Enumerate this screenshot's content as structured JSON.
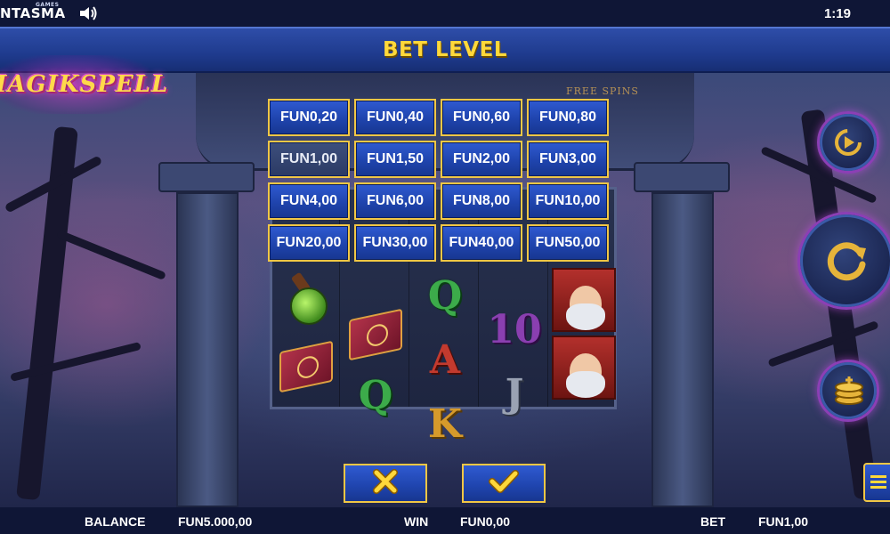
{
  "status_bar": {
    "brand": "NTASMA",
    "brand_small": "GAMES",
    "clock": "1:19",
    "sound_icon": "speaker-icon"
  },
  "header": {
    "title": "BET LEVEL"
  },
  "logo": {
    "text": "MAGIKSPELL"
  },
  "scene": {
    "free_spins_label": "FREE SPINS"
  },
  "bet_options": [
    "FUN0,20",
    "FUN0,40",
    "FUN0,60",
    "FUN0,80",
    "FUN1,00",
    "FUN1,50",
    "FUN2,00",
    "FUN3,00",
    "FUN4,00",
    "FUN6,00",
    "FUN8,00",
    "FUN10,00",
    "FUN20,00",
    "FUN30,00",
    "FUN40,00",
    "FUN50,00"
  ],
  "selected_bet_index": 4,
  "actions": {
    "cancel_icon": "close-icon",
    "confirm_icon": "check-icon"
  },
  "controls": {
    "autoplay_icon": "autoplay-icon",
    "spin_icon": "spin-icon",
    "coins_icon": "coins-icon",
    "menu_icon": "menu-icon"
  },
  "bottom_bar": {
    "balance_label": "BALANCE",
    "balance_value": "FUN5.000,00",
    "win_label": "WIN",
    "win_value": "FUN0,00",
    "bet_label": "BET",
    "bet_value": "FUN1,00"
  },
  "colors": {
    "accent_gold": "#ffd83a",
    "button_blue": "#1f44ad",
    "button_border": "#f1c745",
    "bar_dark": "#0f1636"
  }
}
